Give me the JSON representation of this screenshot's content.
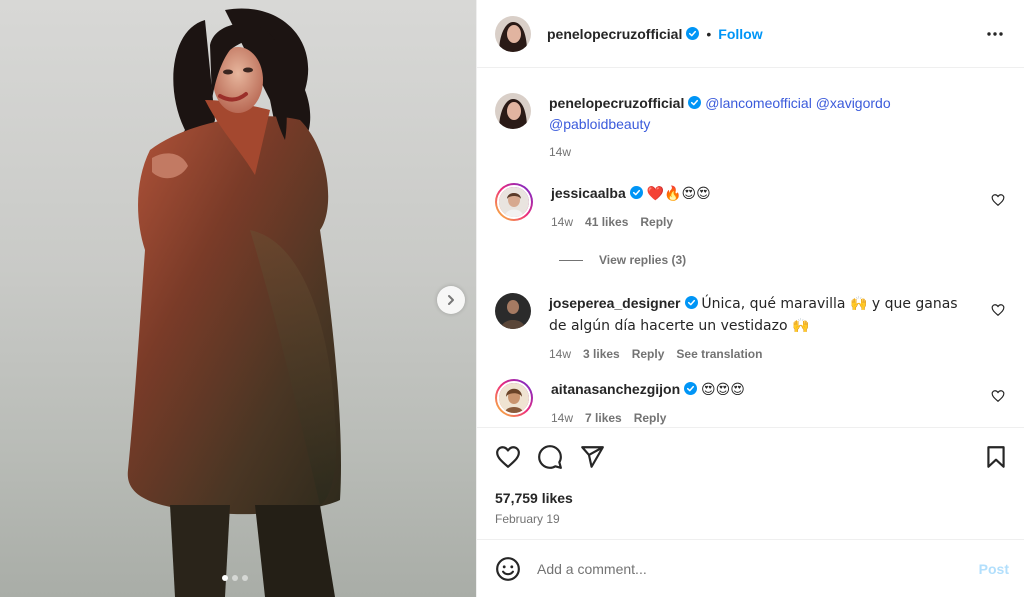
{
  "post": {
    "author": "penelopecruzofficial",
    "follow_label": "Follow",
    "separator": "•",
    "more_icon": "more-horizontal-icon"
  },
  "caption": {
    "username": "penelopecruzofficial",
    "mentions": [
      "@lancomeofficial",
      "@xavigordo",
      "@pabloidbeauty"
    ],
    "time": "14w"
  },
  "comments": [
    {
      "username": "jessicaalba",
      "verified": true,
      "text": "❤️🔥😍😍",
      "time": "14w",
      "likes": "41 likes",
      "reply_label": "Reply",
      "view_replies": "View replies (3)"
    },
    {
      "username": "joseperea_designer",
      "verified": true,
      "text": "Única, qué maravilla 🙌 y que ganas de algún día hacerte un vestidazo 🙌",
      "time": "14w",
      "likes": "3 likes",
      "reply_label": "Reply",
      "translation_label": "See translation"
    },
    {
      "username": "aitanasanchezgijon",
      "verified": true,
      "text": "😍😍😍",
      "time": "14w",
      "likes": "7 likes",
      "reply_label": "Reply"
    }
  ],
  "stats": {
    "likes": "57,759 likes",
    "date": "February 19"
  },
  "add_comment": {
    "placeholder": "Add a comment...",
    "post_label": "Post"
  },
  "carousel": {
    "total": 3,
    "active": 1
  },
  "colors": {
    "accent": "#0095f6",
    "verified": "#0095f6",
    "post_disabled": "#b2dffc",
    "muted": "#737373"
  }
}
